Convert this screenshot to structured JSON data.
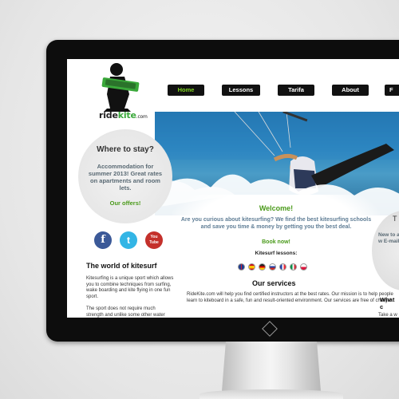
{
  "site": {
    "logo_text_a": "ride",
    "logo_text_b": "kite",
    "logo_text_c": ".com"
  },
  "nav": {
    "items": [
      {
        "label": "Home",
        "active": true
      },
      {
        "label": "Lessons",
        "active": false
      },
      {
        "label": "Tarifa",
        "active": false
      },
      {
        "label": "About",
        "active": false
      },
      {
        "label": "F",
        "active": false
      }
    ]
  },
  "stay": {
    "title": "Where to stay?",
    "body": "Accommodation for summer 2013! Great rates on apartments and room lets.",
    "link": "Our offers!"
  },
  "welcome": {
    "title": "Welcome!",
    "body": "Are you curious about kitesurfing? We find the best kitesurfing schools and save you time & money by getting you the best deal.",
    "link": "Book now!",
    "lessons_label": "Kitesurf lessons:"
  },
  "social": [
    {
      "icon": "facebook-icon",
      "glyph": "f",
      "color": "#3b5998"
    },
    {
      "icon": "twitter-icon",
      "glyph": "t",
      "color": "#33b5e5"
    },
    {
      "icon": "youtube-icon",
      "glyph": "You Tube",
      "color": "#c4302b"
    }
  ],
  "flags": [
    {
      "icon": "uk-flag-icon",
      "colors": [
        "#1d3b8f",
        "#cc1f2f"
      ]
    },
    {
      "icon": "spain-flag-icon",
      "colors": [
        "#c60b1e",
        "#ffc400"
      ]
    },
    {
      "icon": "germany-flag-icon",
      "colors": [
        "#222222",
        "#dd0000"
      ]
    },
    {
      "icon": "russia-flag-icon",
      "colors": [
        "#ffffff",
        "#1c3fa8"
      ]
    },
    {
      "icon": "france-flag-icon",
      "colors": [
        "#1c3fa8",
        "#ed2939"
      ]
    },
    {
      "icon": "italy-flag-icon",
      "colors": [
        "#009246",
        "#ce2b37"
      ]
    },
    {
      "icon": "poland-flag-icon",
      "colors": [
        "#ffffff",
        "#dc143c"
      ]
    }
  ],
  "world": {
    "title": "The world of kitesurf",
    "body": "Kitesurfing is a unique sport which allows you to combine techniques from surfing, wake boarding and kite flying in one fun sport.",
    "body2": "The sport does not require much strength and unlike some other water"
  },
  "services": {
    "title": "Our services",
    "body": "RideKite.com will help you find certified instructors at the best rates. Our mission is to help people learn to kiteboard in a safe, fun and result-oriented environment. Our services are free of charge!"
  },
  "right": {
    "title": "T",
    "body": "New to and w E-mail",
    "what": "What c",
    "take": "Take a w"
  },
  "colors": {
    "accent_green": "#4a9a1a",
    "nav_bg": "#111111",
    "text_blue": "#5f7d95"
  }
}
